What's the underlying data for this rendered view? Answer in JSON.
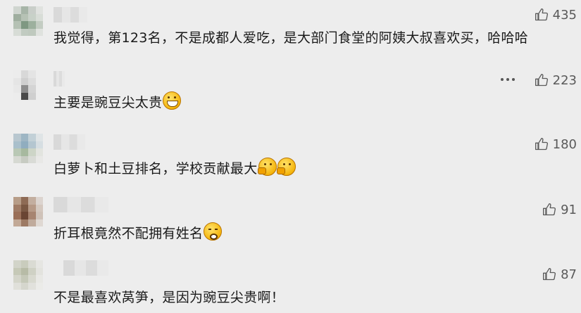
{
  "comments": [
    {
      "text": "我觉得，第123名，不是成都人爱吃，是大部门食堂的阿姨大叔喜欢买，哈哈哈",
      "likes": "435",
      "emoji": ""
    },
    {
      "text": "主要是豌豆尖太贵",
      "likes": "223",
      "emoji": "grin-icon"
    },
    {
      "text": "白萝卜和土豆排名，学校贡献最大",
      "likes": "180",
      "emoji": "thinking-icon"
    },
    {
      "text": "折耳根竟然不配拥有姓名",
      "likes": "91",
      "emoji": "smirk-icon"
    },
    {
      "text": "不是最喜欢莴笋，是因为豌豆尖贵啊！",
      "likes": "87",
      "emoji": ""
    }
  ],
  "icons": {
    "like": "thumbs-up-icon",
    "more": "more-options-icon"
  },
  "colors": {
    "background": "#ededed",
    "text": "#1a1a1a",
    "like": "#5a5a5a"
  }
}
